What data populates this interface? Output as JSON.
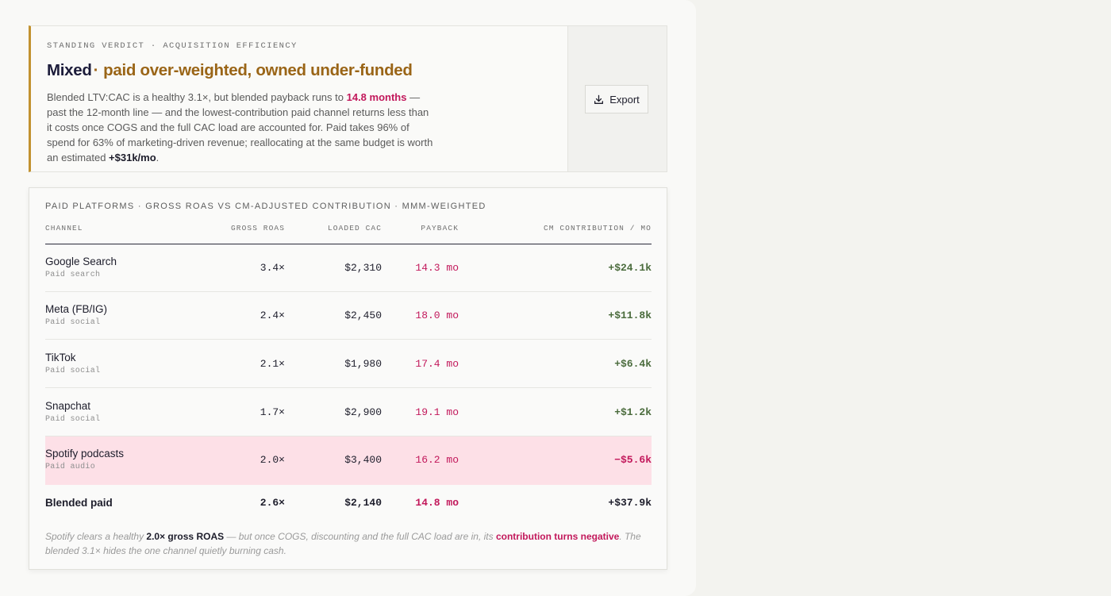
{
  "verdict": {
    "eyebrow": "STANDING VERDICT · ACQUISITION EFFICIENCY",
    "headline_main": "Mixed",
    "headline_dot": "·",
    "headline_detail": "paid over-weighted, owned under-funded",
    "body_1": "Blended LTV:CAC is a healthy 3.1×, but blended payback runs to ",
    "body_highlight": "14.8 months",
    "body_2": " — past the 12-month line — and the lowest-contribution paid channel returns less than it costs once COGS and the full CAC load are accounted for. Paid takes 96% of spend for 63% of marketing-driven revenue; reallocating at the same budget is worth an estimated ",
    "body_strong": "+$31k/mo",
    "body_3": "."
  },
  "export": {
    "label": "Export",
    "icon": "download-icon"
  },
  "table": {
    "title": "PAID PLATFORMS · GROSS ROAS VS CM-ADJUSTED CONTRIBUTION · MMM-WEIGHTED",
    "headers": [
      "CHANNEL",
      "GROSS ROAS",
      "LOADED CAC",
      "PAYBACK",
      "CM CONTRIBUTION / MO"
    ],
    "rows": [
      {
        "name": "Google Search",
        "sub": "Paid search",
        "roas": "3.4×",
        "cac": "$2,310",
        "payback": "14.3 mo",
        "contribution": "+$24.1k"
      },
      {
        "name": "Meta (FB/IG)",
        "sub": "Paid social",
        "roas": "2.4×",
        "cac": "$2,450",
        "payback": "18.0 mo",
        "contribution": "+$11.8k"
      },
      {
        "name": "TikTok",
        "sub": "Paid social",
        "roas": "2.1×",
        "cac": "$1,980",
        "payback": "17.4 mo",
        "contribution": "+$6.4k"
      },
      {
        "name": "Snapchat",
        "sub": "Paid social",
        "roas": "1.7×",
        "cac": "$2,900",
        "payback": "19.1 mo",
        "contribution": "+$1.2k"
      },
      {
        "name": "Spotify podcasts",
        "sub": "Paid audio",
        "roas": "2.0×",
        "cac": "$3,400",
        "payback": "16.2 mo",
        "contribution": "−$5.6k"
      }
    ],
    "total": {
      "name": "Blended paid",
      "roas": "2.6×",
      "cac": "$2,140",
      "payback": "14.8 mo",
      "contribution": "+$37.9k"
    },
    "note": {
      "t1": "Spotify clears a healthy ",
      "b1": "2.0× gross ROAS",
      "t2": " — but once COGS, discounting and the full CAC load are in, its ",
      "b2": "contribution turns negative",
      "t3": ". The blended 3.1× hides the one channel quietly burning cash."
    }
  },
  "colors": {
    "accent": "#c2922f",
    "negative": "#c2185b",
    "positive": "#4a6b3c",
    "highlight_row": "#fde0e7"
  }
}
